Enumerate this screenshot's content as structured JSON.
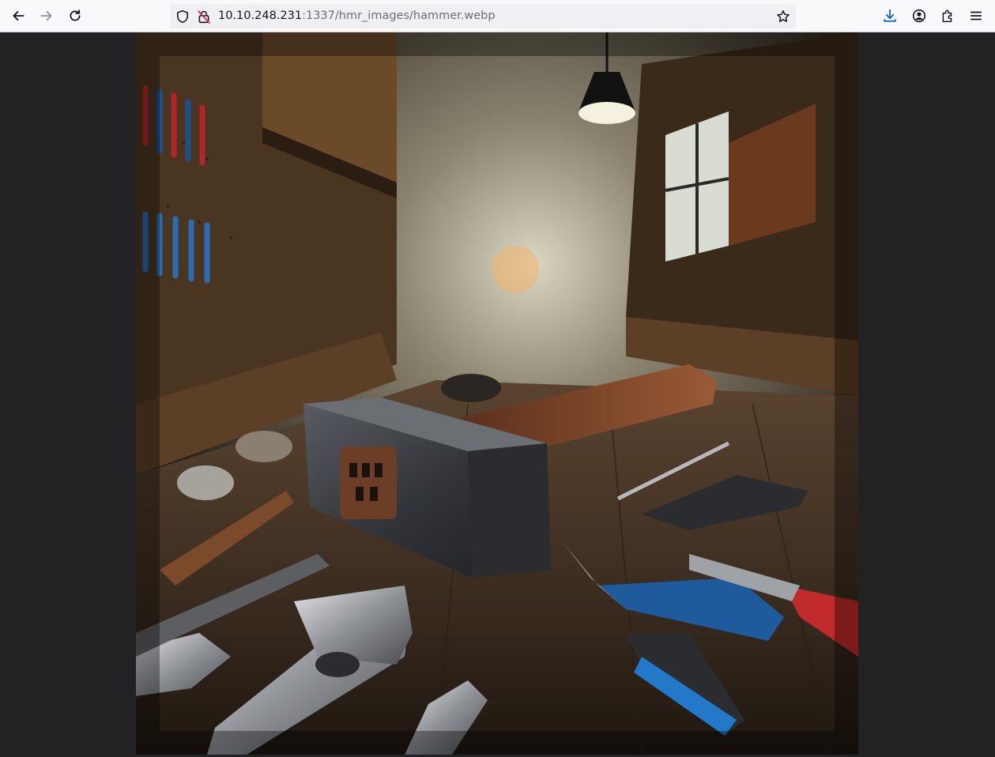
{
  "browser": {
    "nav": {
      "back": "arrow-left-icon",
      "forward": "arrow-right-icon",
      "reload": "reload-icon"
    },
    "url": {
      "host": "10.10.248.231",
      "rest": ":1337/hmr_images/hammer.webp",
      "security_icon": "shield-icon",
      "insecure_icon": "insecure-lock-icon",
      "bookmark_icon": "star-icon"
    },
    "toolbar_icons": [
      "download-icon",
      "account-icon",
      "extensions-icon",
      "menu-icon"
    ],
    "accent": "#0060df"
  },
  "viewer": {
    "background": "#222225",
    "image_alt": "hammer.webp"
  }
}
